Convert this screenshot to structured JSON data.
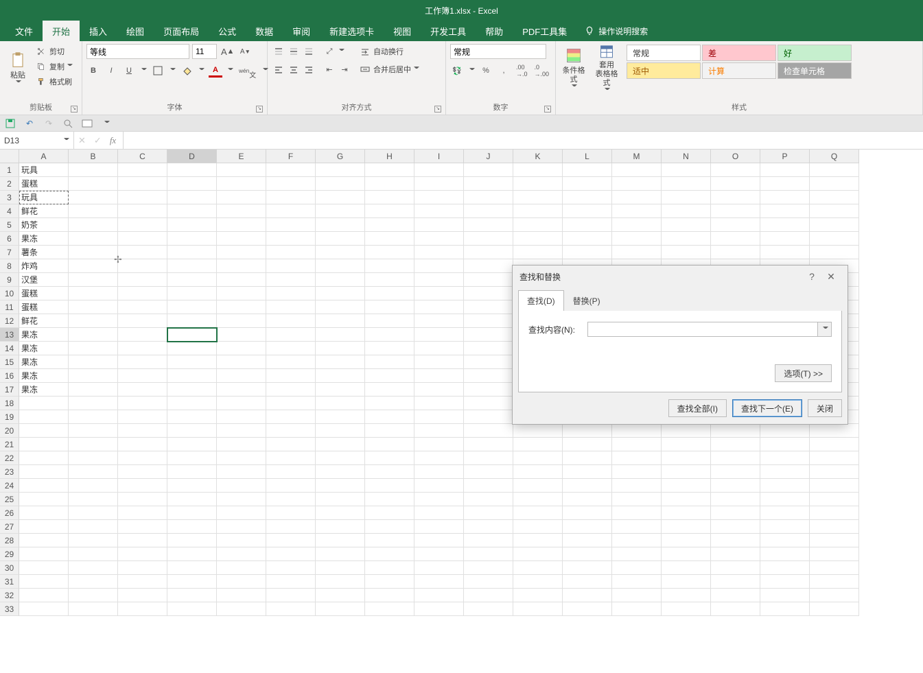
{
  "title": "工作簿1.xlsx - Excel",
  "tabs": [
    "文件",
    "开始",
    "插入",
    "绘图",
    "页面布局",
    "公式",
    "数据",
    "审阅",
    "新建选项卡",
    "视图",
    "开发工具",
    "帮助",
    "PDF工具集"
  ],
  "active_tab_index": 1,
  "tell_me": "操作说明搜索",
  "ribbon": {
    "clipboard": {
      "paste": "粘贴",
      "cut": "剪切",
      "copy": "复制",
      "painter": "格式刷",
      "group": "剪贴板"
    },
    "font": {
      "name": "等线",
      "size": "11",
      "bold": "B",
      "italic": "I",
      "underline": "U",
      "group": "字体"
    },
    "align": {
      "wrap": "自动换行",
      "merge": "合并后居中",
      "group": "对齐方式"
    },
    "number": {
      "format": "常规",
      "group": "数字"
    },
    "styles": {
      "cond": "条件格式",
      "table": "套用\n表格格式",
      "normal": "常规",
      "bad": "差",
      "good": "好",
      "neutral": "适中",
      "calc": "计算",
      "check": "检查单元格",
      "group": "样式"
    }
  },
  "namebox": "D13",
  "formula": "",
  "columns": [
    "A",
    "B",
    "C",
    "D",
    "E",
    "F",
    "G",
    "H",
    "I",
    "J",
    "K",
    "L",
    "M",
    "N",
    "O",
    "P",
    "Q"
  ],
  "rows": 33,
  "active_cell": {
    "row": 13,
    "col": 3
  },
  "marquee_cell": {
    "row": 3,
    "col": 0
  },
  "cell_data": {
    "A1": "玩具",
    "A2": "蛋糕",
    "A3": "玩具",
    "A4": "鲜花",
    "A5": "奶茶",
    "A6": "果冻",
    "A7": "薯条",
    "A8": "炸鸡",
    "A9": "汉堡",
    "A10": "蛋糕",
    "A11": "蛋糕",
    "A12": "鲜花",
    "A13": "果冻",
    "A14": "果冻",
    "A15": "果冻",
    "A16": "果冻",
    "A17": "果冻"
  },
  "dialog": {
    "title": "查找和替换",
    "tab_find": "查找(D)",
    "tab_replace": "替换(P)",
    "find_label": "查找内容(N):",
    "find_value": "",
    "options": "选项(T) >>",
    "find_all": "查找全部(I)",
    "find_next": "查找下一个(E)",
    "close": "关闭"
  }
}
